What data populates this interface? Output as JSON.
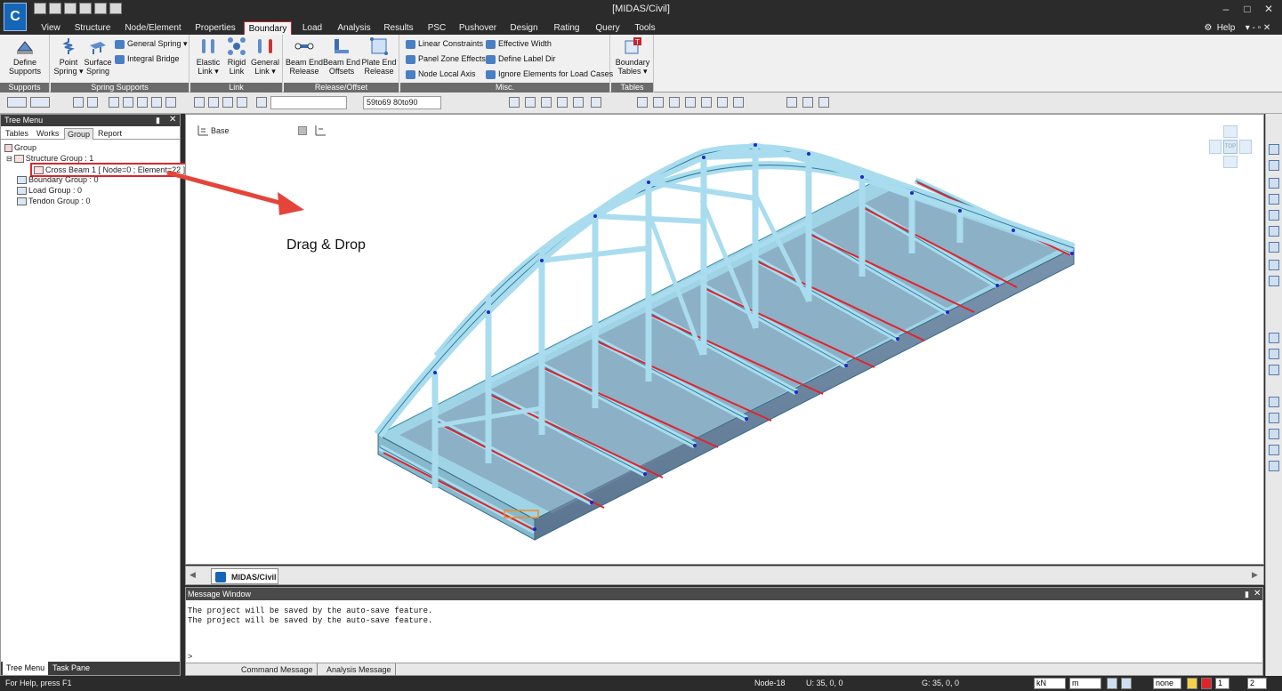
{
  "window": {
    "title": "[MIDAS/Civil]",
    "help": "Help",
    "logo": "C"
  },
  "menu_tabs": [
    "View",
    "Structure",
    "Node/Element",
    "Properties",
    "Boundary",
    "Load",
    "Analysis",
    "Results",
    "PSC",
    "Pushover",
    "Design",
    "Rating",
    "Query",
    "Tools"
  ],
  "active_tab": "Boundary",
  "ribbon": {
    "supports": {
      "label": "Supports",
      "define_supports": "Define\nSupports"
    },
    "spring_supports": {
      "label": "Spring Supports",
      "point_spring": "Point\nSpring ▾",
      "surface_spring": "Surface\nSpring",
      "general_spring": "General Spring ▾",
      "integral_bridge": "Integral Bridge"
    },
    "link": {
      "label": "Link",
      "elastic": "Elastic\nLink ▾",
      "rigid": "Rigid\nLink",
      "general": "General\nLink ▾"
    },
    "release": {
      "label": "Release/Offset",
      "beam_end_release": "Beam End\nRelease",
      "beam_end_offsets": "Beam End\nOffsets",
      "plate_end_release": "Plate End\nRelease"
    },
    "misc": {
      "label": "Misc.",
      "linear_constraints": "Linear Constraints",
      "panel_zone": "Panel Zone Effects",
      "node_local_axis": "Node Local Axis",
      "effective_width": "Effective Width",
      "define_label_dir": "Define Label Dir",
      "ignore_elements": "Ignore Elements for Load Cases"
    },
    "tables": {
      "label": "Tables",
      "boundary_tables": "Boundary\nTables ▾"
    }
  },
  "toolbar": {
    "select_value": "",
    "selection_filter": "59to69 80to90"
  },
  "tree": {
    "header": "Tree Menu",
    "tabs": [
      "Tables",
      "Works",
      "Group",
      "Report"
    ],
    "active_tab": "Group",
    "nodes": {
      "group": "Group",
      "structure_group": "Structure Group : 1",
      "cross_beam": "Cross Beam 1 [ Node=0 ; Element=22 ]",
      "boundary_group": "Boundary Group : 0",
      "load_group": "Load Group : 0",
      "tendon_group": "Tendon Group : 0"
    },
    "footer_tabs": [
      "Tree Menu",
      "Task Pane"
    ]
  },
  "viewport": {
    "base_label": "Base",
    "annotation": "Drag & Drop",
    "view_tab": "MIDAS/Civil",
    "view_cube_top": "TOP"
  },
  "messages": {
    "header": "Message Window",
    "lines": [
      "The project will be saved by the auto-save feature.",
      "The project will be saved by the auto-save feature."
    ],
    "prompt": ">",
    "tabs": [
      "Command Message",
      "Analysis Message"
    ]
  },
  "status": {
    "help": "For Help, press F1",
    "node": "Node-18",
    "u": "U: 35, 0, 0",
    "g": "G: 35, 0, 0",
    "force_unit": "kN",
    "length_unit": "m",
    "none_option": "none",
    "page": "1",
    "page2": "2"
  },
  "colors": {
    "highlight": "#e0242c",
    "model_steel": "#a9dcee",
    "model_shadow": "#6d89a6",
    "accent": "#c4262e"
  }
}
